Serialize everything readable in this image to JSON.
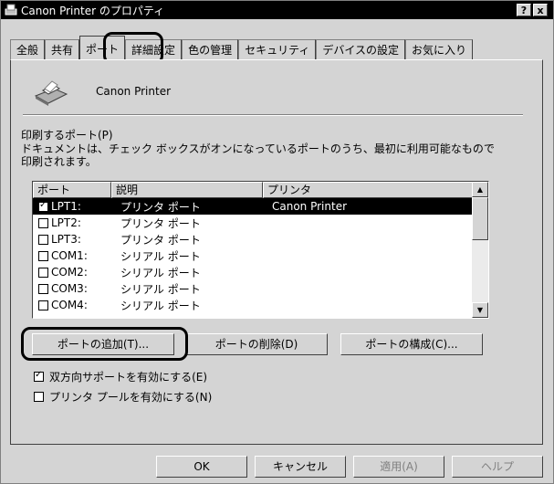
{
  "window": {
    "title": "Canon Printer のプロパティ",
    "help_label": "?",
    "close_label": "x"
  },
  "tabs": [
    {
      "label": "全般"
    },
    {
      "label": "共有"
    },
    {
      "label": "ポート"
    },
    {
      "label": "詳細設定"
    },
    {
      "label": "色の管理"
    },
    {
      "label": "セキュリティ"
    },
    {
      "label": "デバイスの設定"
    },
    {
      "label": "お気に入り"
    }
  ],
  "printer": {
    "name": "Canon Printer"
  },
  "ports_section": {
    "label": "印刷するポート(P)",
    "description_line1": "ドキュメントは、チェック ボックスがオンになっているポートのうち、最初に利用可能なもので",
    "description_line2": "印刷されます。"
  },
  "port_list": {
    "headers": {
      "port": "ポート",
      "description": "説明",
      "printer": "プリンタ"
    },
    "rows": [
      {
        "port": "LPT1:",
        "description": "プリンタ ポート",
        "printer": "Canon Printer",
        "checked": true,
        "selected": true
      },
      {
        "port": "LPT2:",
        "description": "プリンタ ポート",
        "printer": "",
        "checked": false,
        "selected": false
      },
      {
        "port": "LPT3:",
        "description": "プリンタ ポート",
        "printer": "",
        "checked": false,
        "selected": false
      },
      {
        "port": "COM1:",
        "description": "シリアル ポート",
        "printer": "",
        "checked": false,
        "selected": false
      },
      {
        "port": "COM2:",
        "description": "シリアル ポート",
        "printer": "",
        "checked": false,
        "selected": false
      },
      {
        "port": "COM3:",
        "description": "シリアル ポート",
        "printer": "",
        "checked": false,
        "selected": false
      },
      {
        "port": "COM4:",
        "description": "シリアル ポート",
        "printer": "",
        "checked": false,
        "selected": false
      }
    ]
  },
  "port_buttons": {
    "add": "ポートの追加(T)...",
    "delete": "ポートの削除(D)",
    "configure": "ポートの構成(C)..."
  },
  "options": {
    "bidirectional": {
      "label": "双方向サポートを有効にする(E)",
      "checked": true
    },
    "pooling": {
      "label": "プリンタ プールを有効にする(N)",
      "checked": false
    }
  },
  "dialog_buttons": {
    "ok": "OK",
    "cancel": "キャンセル",
    "apply": "適用(A)",
    "help": "ヘルプ"
  }
}
